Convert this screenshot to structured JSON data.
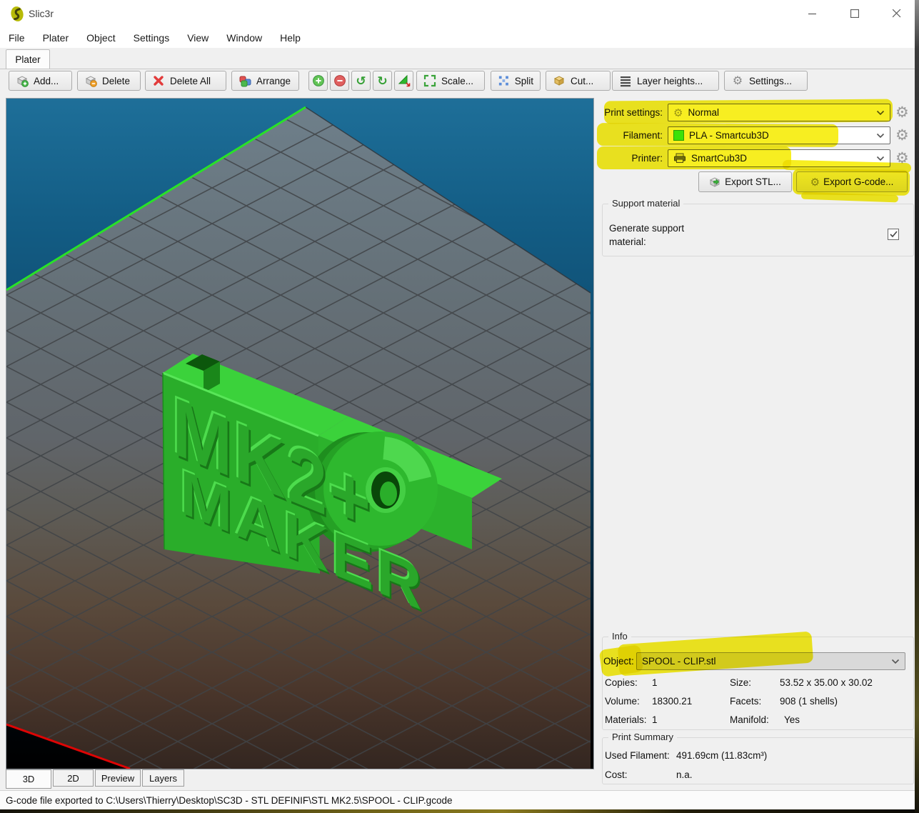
{
  "window": {
    "title": "Slic3r"
  },
  "menu": {
    "items": [
      "File",
      "Plater",
      "Object",
      "Settings",
      "View",
      "Window",
      "Help"
    ]
  },
  "tabs": {
    "plater": "Plater"
  },
  "toolbar": {
    "add": "Add...",
    "delete": "Delete",
    "delete_all": "Delete All",
    "arrange": "Arrange",
    "scale": "Scale...",
    "split": "Split",
    "cut": "Cut...",
    "layer_heights": "Layer heights...",
    "settings": "Settings...",
    "icon_buttons": [
      "increase-copies-icon",
      "decrease-copies-icon",
      "rotate-ccw-icon",
      "rotate-cw-icon",
      "change-scale-icon"
    ]
  },
  "sidebar": {
    "print_settings_label": "Print settings:",
    "print_settings_value": "Normal",
    "filament_label": "Filament:",
    "filament_value": "PLA - Smartcub3D",
    "printer_label": "Printer:",
    "printer_value": "SmartCub3D",
    "export_stl": "Export STL...",
    "export_gcode": "Export G-code...",
    "support": {
      "legend": "Support material",
      "generate_label_line1": "Generate support",
      "generate_label_line2": "material:",
      "checked": true
    },
    "info": {
      "legend": "Info",
      "object_label": "Object:",
      "object_value": "SPOOL - CLIP.stl",
      "copies_label": "Copies:",
      "copies": "1",
      "size_label": "Size:",
      "size": "53.52 x 35.00 x 30.02",
      "volume_label": "Volume:",
      "volume": "18300.21",
      "facets_label": "Facets:",
      "facets": "908 (1 shells)",
      "materials_label": "Materials:",
      "materials": "1",
      "manifold_label": "Manifold:",
      "manifold": "Yes"
    },
    "summary": {
      "legend": "Print Summary",
      "used_filament_label": "Used Filament:",
      "used_filament": "491.69cm (11.83cm³)",
      "cost_label": "Cost:",
      "cost": "n.a."
    }
  },
  "viewport": {
    "model_text_top": "MK2+",
    "model_text_bottom": "MAKER"
  },
  "bottom_tabs": {
    "t3d": "3D",
    "t2d": "2D",
    "preview": "Preview",
    "layers": "Layers",
    "active": "3D"
  },
  "statusbar": {
    "text": "G-code file exported to C:\\Users\\Thierry\\Desktop\\SC3D - STL DEFINIF\\STL MK2.5\\SPOOL - CLIP.gcode"
  },
  "colors": {
    "highlight": "#f6ec00",
    "model_green": "#2eb82e",
    "bed_blue": "#135d85",
    "filament_swatch": "#3ef23e",
    "bed_edge_green": "#28e228",
    "bed_edge_red": "#dd0505"
  }
}
